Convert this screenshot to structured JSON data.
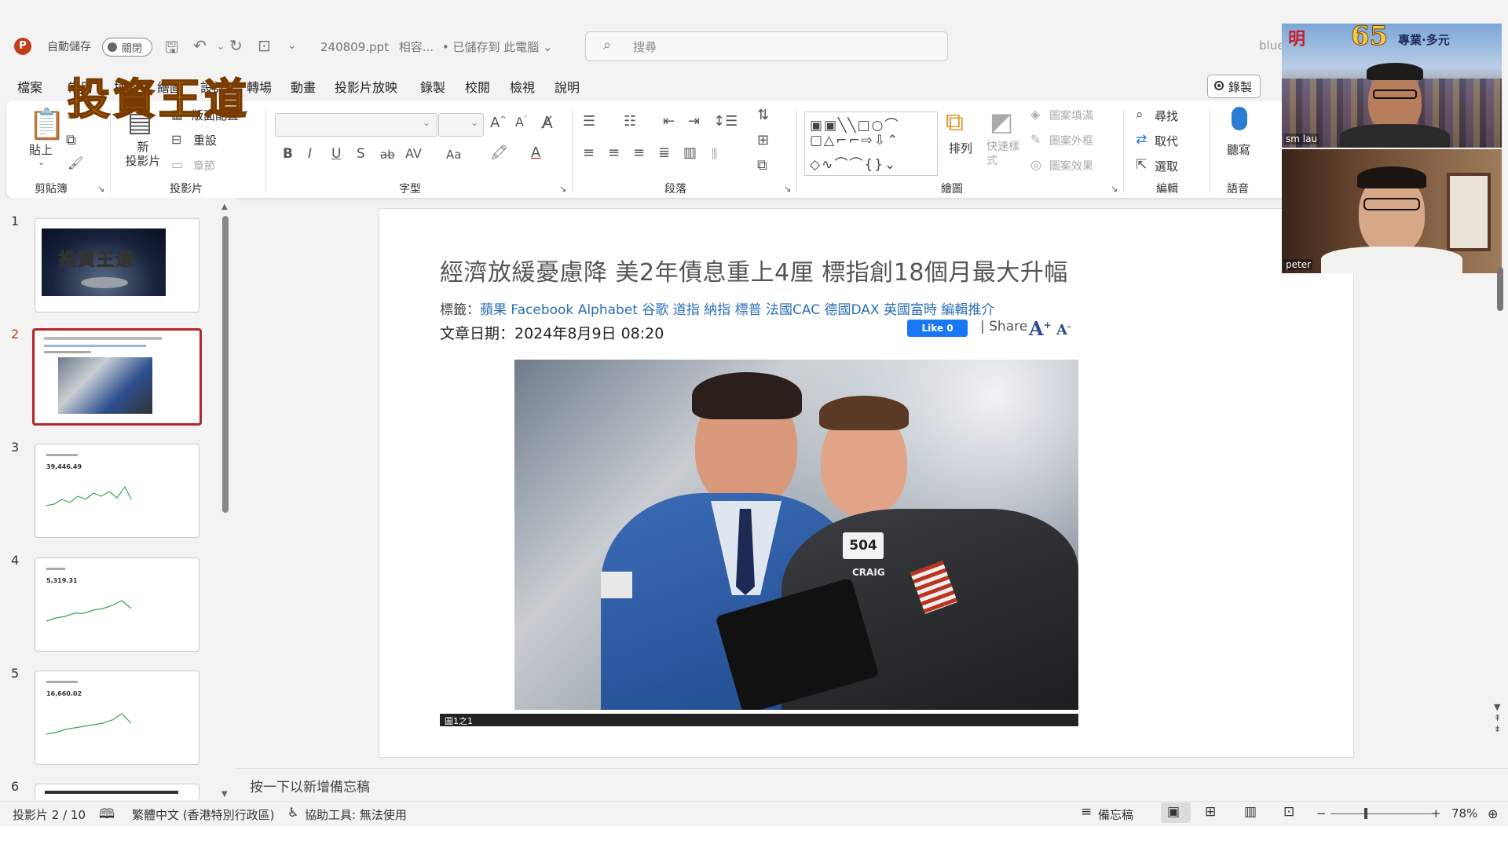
{
  "app": {
    "autosave_label": "自動儲存",
    "autosave_state": "關閉",
    "filename": "240809.ppt",
    "compat": "相容...",
    "saved_status": "已儲存到 此電腦",
    "search_placeholder": "搜尋",
    "user": "blue"
  },
  "menu": [
    "檔案",
    "常用",
    "插入",
    "繪圖",
    "設計",
    "轉場",
    "動畫",
    "投影片放映",
    "錄製",
    "校閱",
    "檢視",
    "說明"
  ],
  "overlay_logo": "投資王道",
  "record_button": "錄製",
  "ribbon": {
    "clipboard": {
      "paste": "貼上",
      "label": "剪貼簿"
    },
    "slides": {
      "new_slide": "新\n投影片",
      "layout": "版面配置",
      "reset": "重設",
      "section": "章節",
      "label": "投影片"
    },
    "font": {
      "label": "字型"
    },
    "paragraph": {
      "label": "段落"
    },
    "drawing": {
      "arrange": "排列",
      "quick_styles": "快速樣式",
      "shape_fill": "圖案填滿",
      "shape_outline": "圖案外框",
      "shape_effects": "圖案效果",
      "label": "繪圖"
    },
    "editing": {
      "find": "尋找",
      "replace": "取代",
      "select": "選取",
      "label": "編輯"
    },
    "voice": {
      "dictate": "聽寫",
      "label": "語音"
    }
  },
  "slides": {
    "numbers": [
      "1",
      "2",
      "3",
      "4",
      "5",
      "6"
    ],
    "thumb1_text": "投資王道",
    "thumb3_value": "39,446.49",
    "thumb4_value": "5,319.31",
    "thumb5_value": "16,660.02"
  },
  "slide": {
    "title": "經濟放緩憂慮降 美2年債息重上4厘 標指創18個月最大升幅",
    "tags_label": "標籤：",
    "tags": [
      "蘋果",
      "Facebook",
      "Alphabet",
      "谷歌",
      "道指",
      "納指",
      "標普",
      "法國CAC",
      "德國DAX",
      "英國富時",
      "編輯推介"
    ],
    "date": "文章日期：2024年8月9日 08:20",
    "like": "Like 0",
    "share": "| Share",
    "badge_number": "504",
    "name_tag": "CRAIG",
    "caption": "圖1之1"
  },
  "notes_placeholder": "按一下以新增備忘稿",
  "status": {
    "slide_count": "投影片 2 / 10",
    "language": "繁體中文 (香港特別行政區)",
    "accessibility": "協助工具: 無法使用",
    "notes": "備忘稿",
    "zoom": "78%"
  },
  "video": {
    "p1_name": "sm lau",
    "p1_banner": "65",
    "p1_banner_text": "專業·多元",
    "p2_name": "peter"
  }
}
